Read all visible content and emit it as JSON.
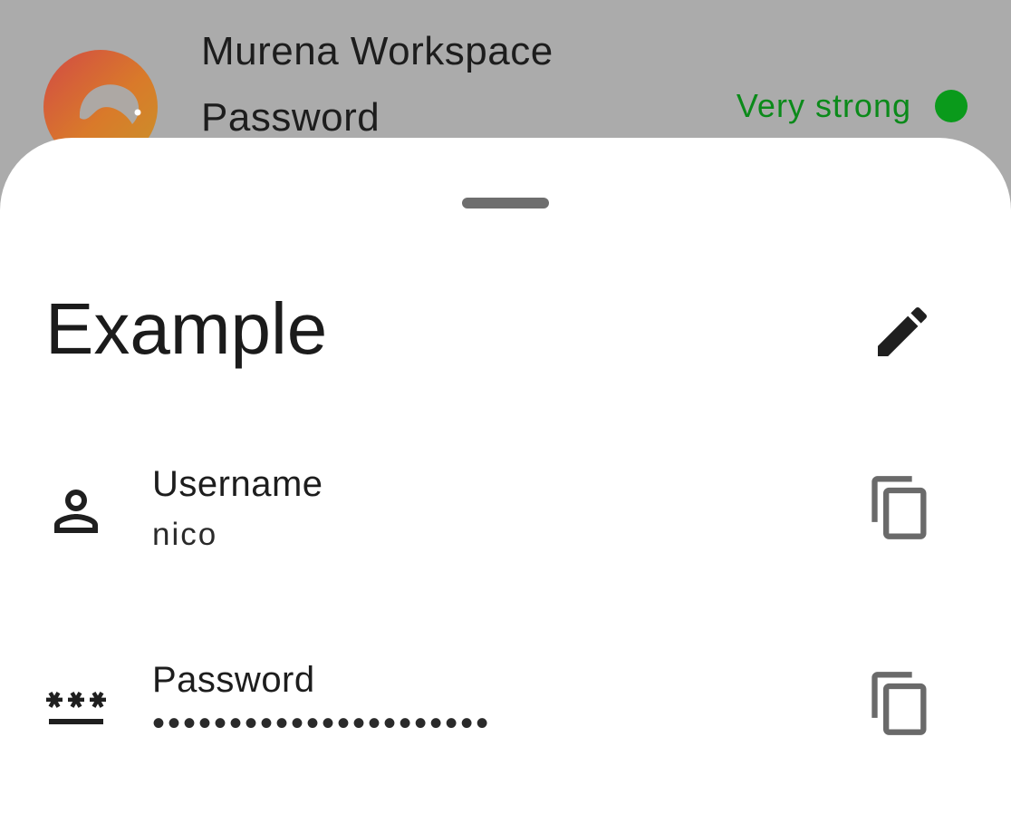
{
  "background_item": {
    "title": "Murena Workspace",
    "subtitle": "Password",
    "logo_icon": "murena-logo-icon",
    "strength_label": "Very strong",
    "strength_color": "#0a9a1b"
  },
  "sheet": {
    "title": "Example",
    "edit_icon": "pencil-icon",
    "fields": {
      "username": {
        "label": "Username",
        "value": "nico",
        "icon": "person-icon",
        "copy_icon": "copy-icon"
      },
      "password": {
        "label": "Password",
        "value": "••••••••••••••••••••••",
        "icon": "password-icon",
        "copy_icon": "copy-icon"
      }
    }
  }
}
